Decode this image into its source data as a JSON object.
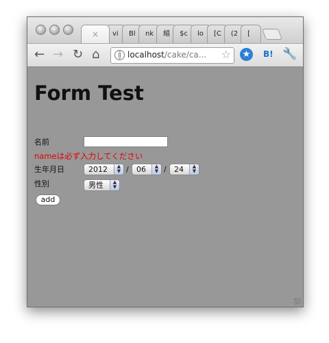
{
  "browser": {
    "tabs": [
      "vi",
      "Bl",
      "nk",
      "組",
      "$c",
      "lo",
      "[C",
      "(2",
      "["
    ],
    "active_tab_close": "×",
    "url_host": "localhost",
    "url_path": "/cake/ca...",
    "extension_label": "B!",
    "icons": [
      "back-icon",
      "forward-icon",
      "reload-icon",
      "home-icon",
      "globe-icon",
      "bookmark-star-icon",
      "extension-star-icon",
      "wrench-icon"
    ]
  },
  "page": {
    "title": "Form Test",
    "name_label": "名前",
    "name_value": "",
    "name_error": "nameは必ず入力してください",
    "birthdate_label": "生年月日",
    "year": "2012",
    "month": "06",
    "day": "24",
    "date_separator": "/",
    "gender_label": "性別",
    "gender": "男性",
    "submit_label": "add"
  },
  "colors": {
    "page_background": "#989898",
    "error_text": "#e10000"
  }
}
